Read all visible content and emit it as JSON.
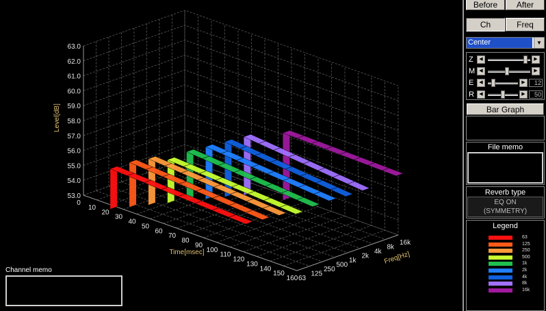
{
  "toolbar": {
    "before_label": "Before",
    "after_label": "After",
    "ch_label": "Ch",
    "freq_label": "Freq"
  },
  "channel_select": {
    "value": "Center"
  },
  "sliders": [
    {
      "label": "Z",
      "value": 0.92,
      "readout": ""
    },
    {
      "label": "M",
      "value": 0.45,
      "readout": ""
    },
    {
      "label": "E",
      "value": 0.12,
      "readout": "12"
    },
    {
      "label": "R",
      "value": 0.5,
      "readout": "50"
    }
  ],
  "bar_graph_label": "Bar Graph",
  "file_memo": {
    "title": "File memo",
    "text": ""
  },
  "reverb": {
    "title": "Reverb type",
    "line1": "EQ ON",
    "line2": "(SYMMETRY)"
  },
  "legend": {
    "title": "Legend",
    "items": [
      {
        "label": "63",
        "color": "#ff1010"
      },
      {
        "label": "125",
        "color": "#ff5a1a"
      },
      {
        "label": "250",
        "color": "#ff9a3c"
      },
      {
        "label": "500",
        "color": "#c8ff30"
      },
      {
        "label": "1k",
        "color": "#20c050"
      },
      {
        "label": "2k",
        "color": "#2080ff"
      },
      {
        "label": "4k",
        "color": "#1060e0"
      },
      {
        "label": "8k",
        "color": "#a070ff"
      },
      {
        "label": "16k",
        "color": "#a01aa0"
      }
    ]
  },
  "channel_memo": {
    "title": "Channel memo",
    "text": ""
  },
  "chart_data": {
    "type": "surface3d",
    "ylabel": "Level[dB]",
    "xlabel": "Time[msec]",
    "zlabel": "Freq[Hz]",
    "y_ticks": [
      "53.0",
      "54.0",
      "55.0",
      "56.0",
      "57.0",
      "58.0",
      "59.0",
      "60.0",
      "61.0",
      "62.0",
      "63.0"
    ],
    "ylim": [
      53,
      63
    ],
    "x_ticks": [
      "0",
      "10",
      "20",
      "30",
      "40",
      "50",
      "60",
      "70",
      "80",
      "90",
      "100",
      "110",
      "120",
      "130",
      "140",
      "150",
      "160"
    ],
    "xlim": [
      0,
      160
    ],
    "z_ticks": [
      "63",
      "125",
      "250",
      "500",
      "1k",
      "2k",
      "4k",
      "8k",
      "16k"
    ],
    "grid": true,
    "series": [
      {
        "name": "63",
        "onset": 20,
        "peak": 55.4,
        "end": 54.9
      },
      {
        "name": "125",
        "onset": 25,
        "peak": 55.7,
        "end": 55.0
      },
      {
        "name": "250",
        "onset": 30,
        "peak": 55.8,
        "end": 55.1
      },
      {
        "name": "500",
        "onset": 35,
        "peak": 55.6,
        "end": 55.0
      },
      {
        "name": "1k",
        "onset": 40,
        "peak": 56.0,
        "end": 55.3
      },
      {
        "name": "2k",
        "onset": 45,
        "peak": 56.2,
        "end": 55.5
      },
      {
        "name": "4k",
        "onset": 50,
        "peak": 56.4,
        "end": 55.6
      },
      {
        "name": "8k",
        "onset": 55,
        "peak": 56.6,
        "end": 55.8
      },
      {
        "name": "16k",
        "onset": 75,
        "peak": 57.2,
        "end": 57.0
      }
    ]
  }
}
